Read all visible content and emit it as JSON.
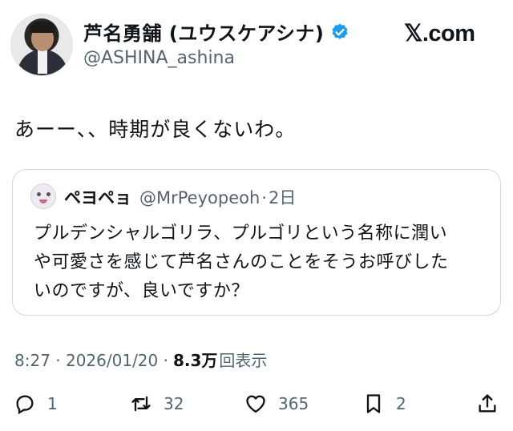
{
  "author": {
    "display_name": "芦名勇舗 (ユウスケアシナ)",
    "handle": "@ASHINA_ashina",
    "verified_icon": "verified-badge-icon",
    "verified_color": "#1d9bf0"
  },
  "brand": "𝕏.com",
  "tweet": {
    "text": "あーー、、時期が良くないわ。"
  },
  "quote": {
    "name": "ペヨペョ",
    "handle": "@MrPeyopeoh",
    "separator": "·",
    "time": "2日",
    "lines": [
      "プルデンシャルゴリラ、プルゴリという名称に潤い",
      "や可愛さを感じて芦名さんのことをそうお呼びした",
      "いのですが、良いですか？"
    ]
  },
  "meta": {
    "timestamp": "8:27 · 2026/01/20 ·",
    "views_count": "8.3万",
    "views_label": "回表示"
  },
  "actions": {
    "reply_count": "1",
    "retweet_count": "32",
    "like_count": "365",
    "bookmark_count": "2"
  }
}
